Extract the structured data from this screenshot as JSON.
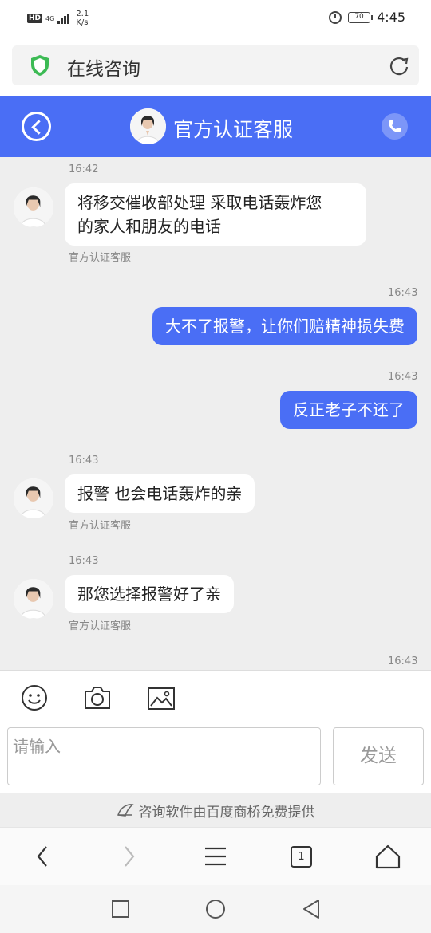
{
  "status_bar": {
    "hd": "HD",
    "network": "4G",
    "speed_value": "2.1",
    "speed_unit": "K/s",
    "battery": "70",
    "time": "4:45"
  },
  "browser": {
    "page_title": "在线咨询",
    "tab_count": "1"
  },
  "chat_header": {
    "title": "官方认证客服"
  },
  "messages": [
    {
      "time": "16:42",
      "side": "in",
      "text_line1": "将移交催收部处理 采取电话轰炸您",
      "text_line2": "的家人和朋友的电话",
      "sender": "官方认证客服"
    },
    {
      "time": "16:43",
      "side": "out",
      "text": "大不了报警，让你们赔精神损失费"
    },
    {
      "time": "16:43",
      "side": "out",
      "text": "反正老子不还了"
    },
    {
      "time": "16:43",
      "side": "in",
      "text": "报警 也会电话轰炸的亲",
      "sender": "官方认证客服"
    },
    {
      "time": "16:43",
      "side": "in",
      "text": "那您选择报警好了亲",
      "sender": "官方认证客服"
    },
    {
      "time": "16:43"
    }
  ],
  "input": {
    "placeholder": "请输入",
    "send_label": "发送"
  },
  "footer": {
    "powered_by": "咨询软件由百度商桥免费提供"
  },
  "colors": {
    "accent": "#4a6ef5",
    "chat_bg": "#eeeeee"
  }
}
